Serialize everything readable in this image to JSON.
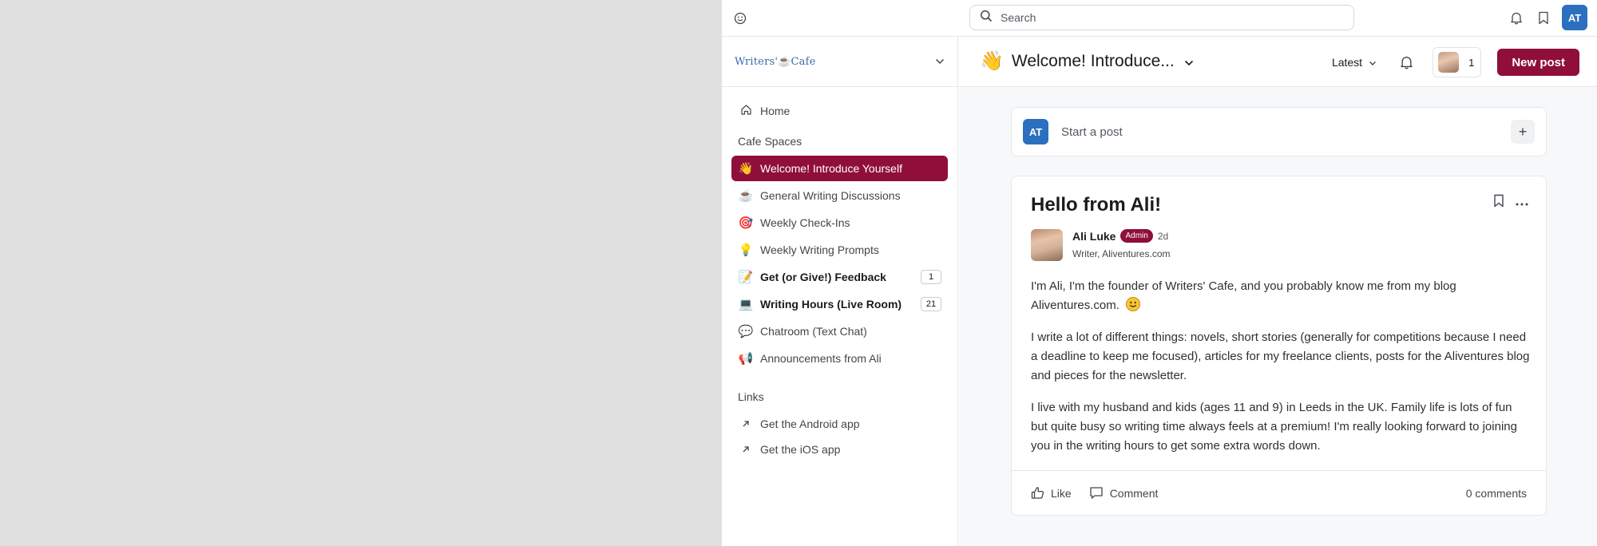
{
  "topbar": {
    "search_placeholder": "Search",
    "user_initials": "AT",
    "icons": [
      "smiley-icon",
      "search-icon",
      "bell-icon",
      "bookmark-icon"
    ]
  },
  "community": {
    "name_left": "Writers'",
    "name_cup": "☕",
    "name_right": "Cafe"
  },
  "sidebar": {
    "home_label": "Home",
    "spaces_title": "Cafe Spaces",
    "spaces": [
      {
        "emoji": "👋",
        "label": "Welcome! Introduce Yourself",
        "active": true,
        "bold": false,
        "count": ""
      },
      {
        "emoji": "☕",
        "label": "General Writing Discussions",
        "active": false,
        "bold": false,
        "count": ""
      },
      {
        "emoji": "🎯",
        "label": "Weekly Check-Ins",
        "active": false,
        "bold": false,
        "count": ""
      },
      {
        "emoji": "💡",
        "label": "Weekly Writing Prompts",
        "active": false,
        "bold": false,
        "count": ""
      },
      {
        "emoji": "📝",
        "label": "Get (or Give!) Feedback",
        "active": false,
        "bold": true,
        "count": "1"
      },
      {
        "emoji": "💻",
        "label": "Writing Hours (Live Room)",
        "active": false,
        "bold": true,
        "count": "21"
      },
      {
        "emoji": "💬",
        "label": "Chatroom (Text Chat)",
        "active": false,
        "bold": false,
        "count": ""
      },
      {
        "emoji": "📢",
        "label": "Announcements from Ali",
        "active": false,
        "bold": false,
        "count": ""
      }
    ],
    "links_title": "Links",
    "links": [
      {
        "label": "Get the Android app"
      },
      {
        "label": "Get the iOS app"
      }
    ]
  },
  "space_header": {
    "emoji": "👋",
    "title": "Welcome! Introduce...",
    "sort_label": "Latest",
    "member_count": "1",
    "new_post_label": "New post"
  },
  "composer": {
    "user_initials": "AT",
    "placeholder": "Start a post",
    "plus": "+"
  },
  "post": {
    "title": "Hello from Ali!",
    "author_name": "Ali Luke",
    "badge": "Admin",
    "time": "2d",
    "author_headline": "Writer, Aliventures.com",
    "paragraphs": [
      "I'm Ali, I'm the founder of Writers' Cafe, and you probably know me from my blog Aliventures.com.",
      "I write a lot of different things: novels, short stories (generally for competitions because I need a deadline to keep me focused), articles for my freelance clients, posts for the Aliventures blog and pieces for the newsletter.",
      "I live with my husband and kids (ages 11 and 9) in Leeds in the UK. Family life is lots of fun but quite busy so writing time always feels at a premium! I'm really looking forward to joining you in the writing hours to get some extra words down."
    ],
    "like_label": "Like",
    "comment_label": "Comment",
    "comments_count": "0 comments"
  },
  "colors": {
    "accent": "#8f0f3a",
    "avatar": "#2c6fbf"
  }
}
